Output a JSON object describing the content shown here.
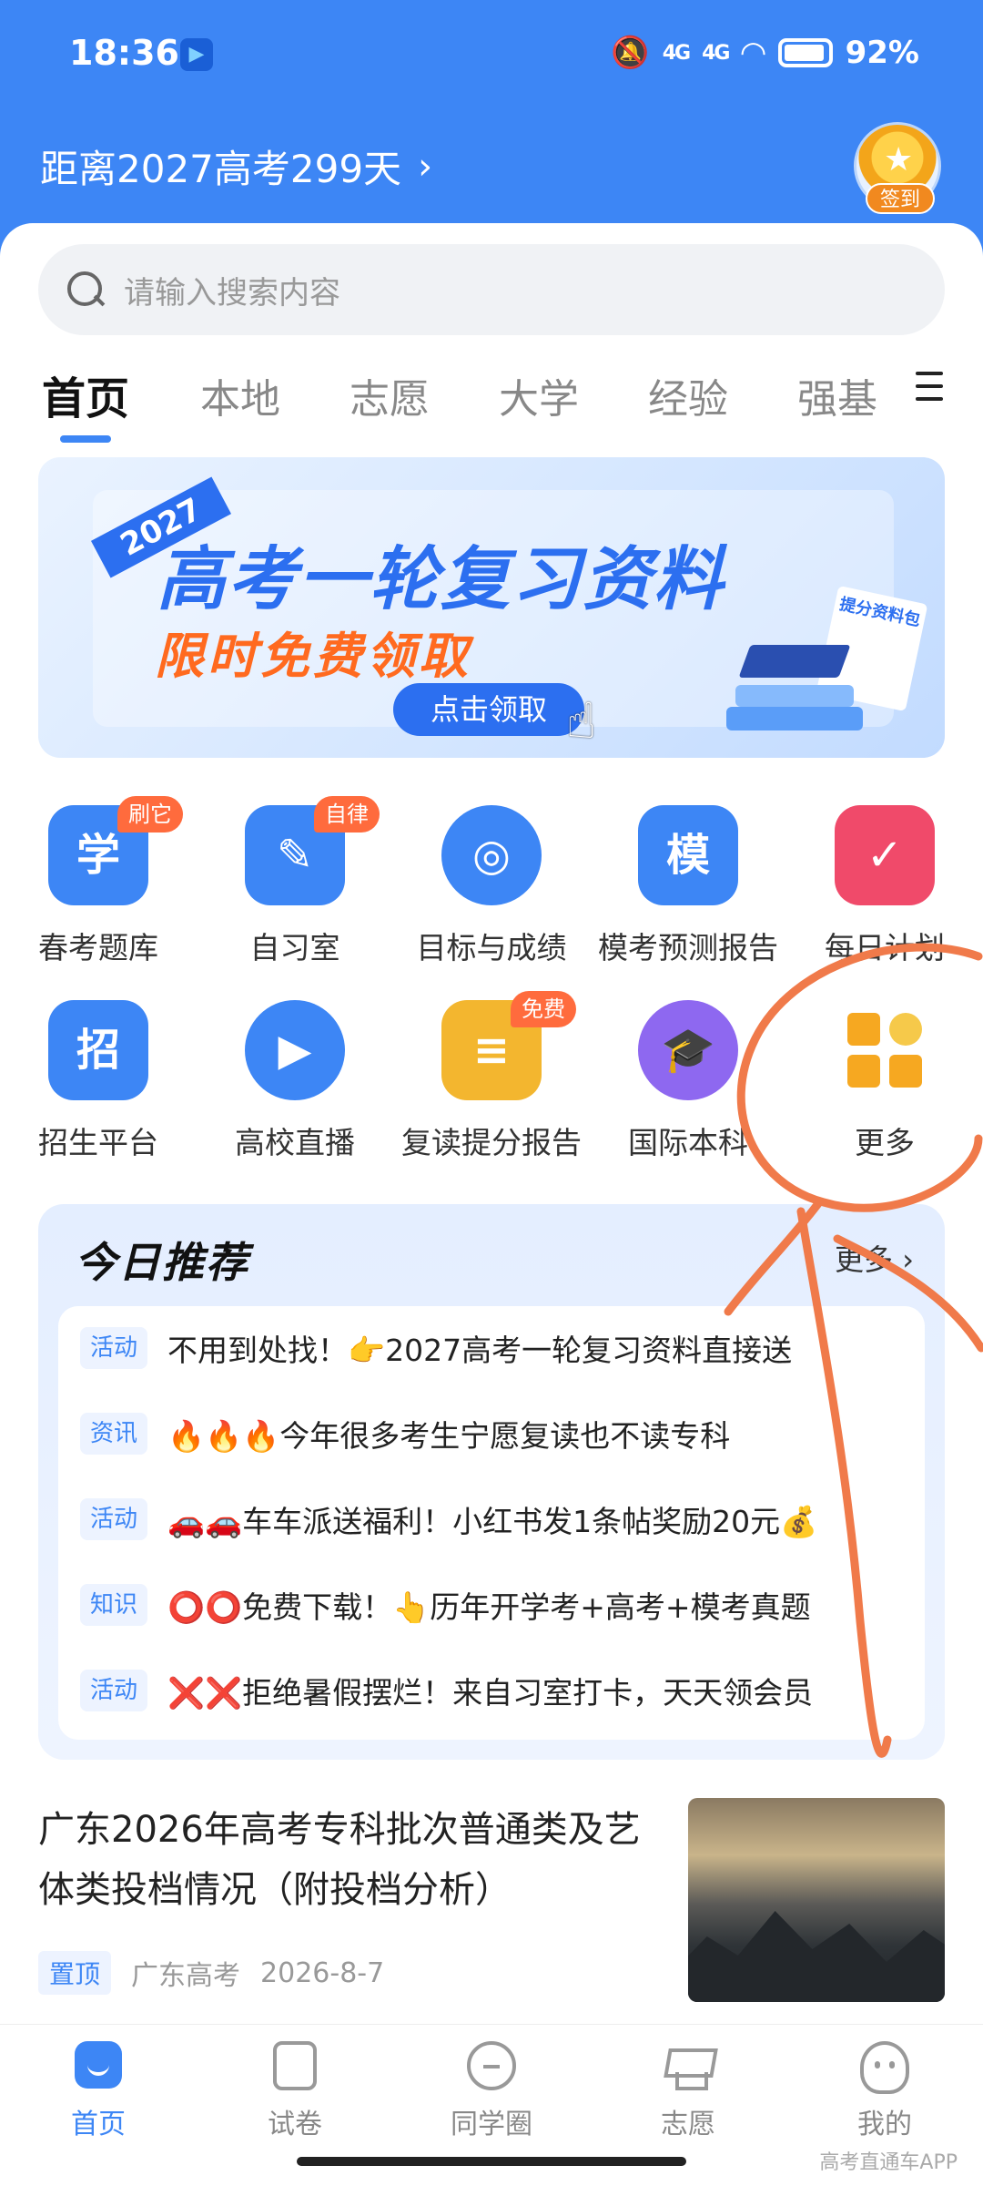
{
  "status_bar": {
    "time": "18:36",
    "signal_1": "4G",
    "signal_2": "4G",
    "battery": "92%"
  },
  "header": {
    "countdown": "距离2027高考299天",
    "signin_label": "签到"
  },
  "search": {
    "placeholder": "请输入搜索内容"
  },
  "tabs": [
    {
      "label": "首页",
      "active": true
    },
    {
      "label": "本地"
    },
    {
      "label": "志愿"
    },
    {
      "label": "大学"
    },
    {
      "label": "经验"
    },
    {
      "label": "强基"
    }
  ],
  "banner": {
    "year": "2027",
    "headline": "高考一轮复习资料",
    "subline": "限时免费领取",
    "button": "点击领取",
    "tag": "提分资料包"
  },
  "grid": [
    {
      "label": "春考题库",
      "badge": "刷它",
      "glyph": "学",
      "color": "#3d86f5",
      "icon": "book-icon"
    },
    {
      "label": "自习室",
      "badge": "自律",
      "glyph": "✎",
      "color": "#3d86f5",
      "icon": "study-room-icon"
    },
    {
      "label": "目标与成绩",
      "badge": "",
      "glyph": "◎",
      "color": "#3d86f5",
      "icon": "target-icon"
    },
    {
      "label": "模考预测报告",
      "badge": "",
      "glyph": "模",
      "color": "#3d86f5",
      "icon": "exam-report-icon"
    },
    {
      "label": "每日计划",
      "badge": "",
      "glyph": "✓",
      "color": "#f04a6a",
      "icon": "calendar-icon"
    },
    {
      "label": "招生平台",
      "badge": "",
      "glyph": "招",
      "color": "#3d86f5",
      "icon": "admission-icon"
    },
    {
      "label": "高校直播",
      "badge": "",
      "glyph": "▶",
      "color": "#3d86f5",
      "icon": "live-video-icon"
    },
    {
      "label": "复读提分报告",
      "badge": "免费",
      "glyph": "≡",
      "color": "#f3b62f",
      "icon": "report-icon"
    },
    {
      "label": "国际本科",
      "badge": "",
      "glyph": "🎓",
      "color": "#8e68f0",
      "icon": "graduation-cap-icon"
    },
    {
      "label": "更多",
      "badge": "",
      "glyph": "",
      "color": "#f6a821",
      "icon": "more-grid-icon"
    }
  ],
  "recommend": {
    "title": "今日推荐",
    "more": "更多",
    "items": [
      {
        "tag": "活动",
        "text": "不用到处找！👉2027高考一轮复习资料直接送"
      },
      {
        "tag": "资讯",
        "text": "🔥🔥🔥今年很多考生宁愿复读也不读专科"
      },
      {
        "tag": "活动",
        "text": "🚗🚗车车派送福利！小红书发1条帖奖励20元💰"
      },
      {
        "tag": "知识",
        "text": "⭕⭕免费下载！👆历年开学考+高考+模考真题"
      },
      {
        "tag": "活动",
        "text": "❌❌拒绝暑假摆烂！来自习室打卡，天天领会员"
      }
    ]
  },
  "article": {
    "title": "广东2026年高考专科批次普通类及艺体类投档情况（附投档分析）",
    "pin": "置顶",
    "source": "广东高考",
    "date": "2026-8-7"
  },
  "bottom_nav": [
    {
      "label": "首页",
      "active": true
    },
    {
      "label": "试卷"
    },
    {
      "label": "同学圈"
    },
    {
      "label": "志愿"
    },
    {
      "label": "我的"
    }
  ],
  "watermark": "高考直通车APP",
  "colors": {
    "primary": "#3d86f5",
    "annotation": "#f07a4a"
  }
}
